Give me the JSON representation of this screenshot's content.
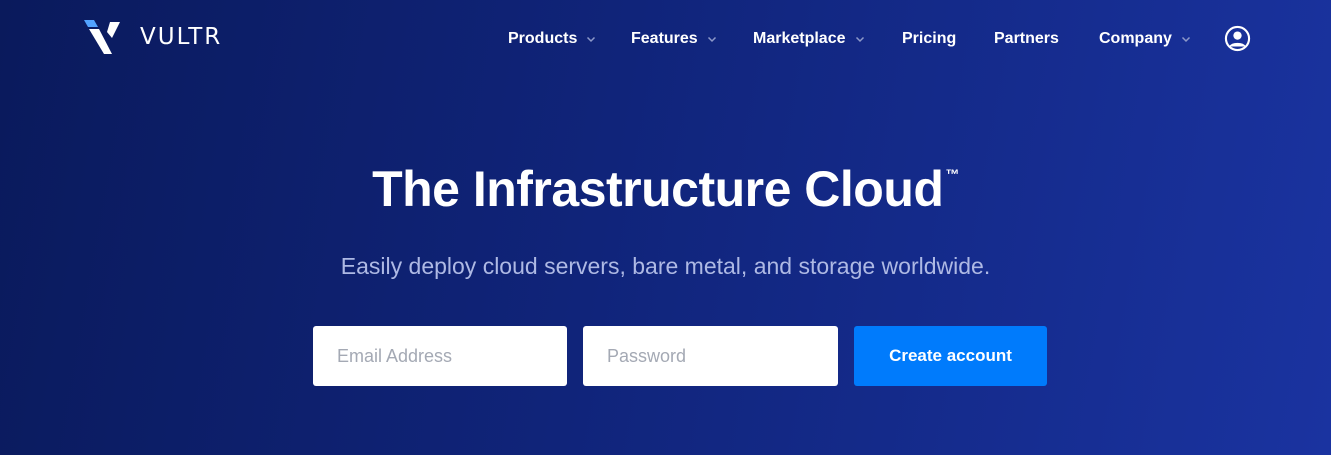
{
  "brand": {
    "name": "VULTR",
    "accent": "#007bfc",
    "logo_light": "#52a3ff"
  },
  "nav": {
    "items": [
      {
        "label": "Products",
        "has_dropdown": true
      },
      {
        "label": "Features",
        "has_dropdown": true
      },
      {
        "label": "Marketplace",
        "has_dropdown": true
      },
      {
        "label": "Pricing",
        "has_dropdown": false
      },
      {
        "label": "Partners",
        "has_dropdown": false
      },
      {
        "label": "Company",
        "has_dropdown": true
      }
    ],
    "account_icon": "user-circle-icon"
  },
  "hero": {
    "title": "The Infrastructure Cloud",
    "title_mark": "™",
    "subtitle": "Easily deploy cloud servers, bare metal, and storage worldwide."
  },
  "signup": {
    "email_placeholder": "Email Address",
    "password_placeholder": "Password",
    "button_label": "Create account"
  }
}
